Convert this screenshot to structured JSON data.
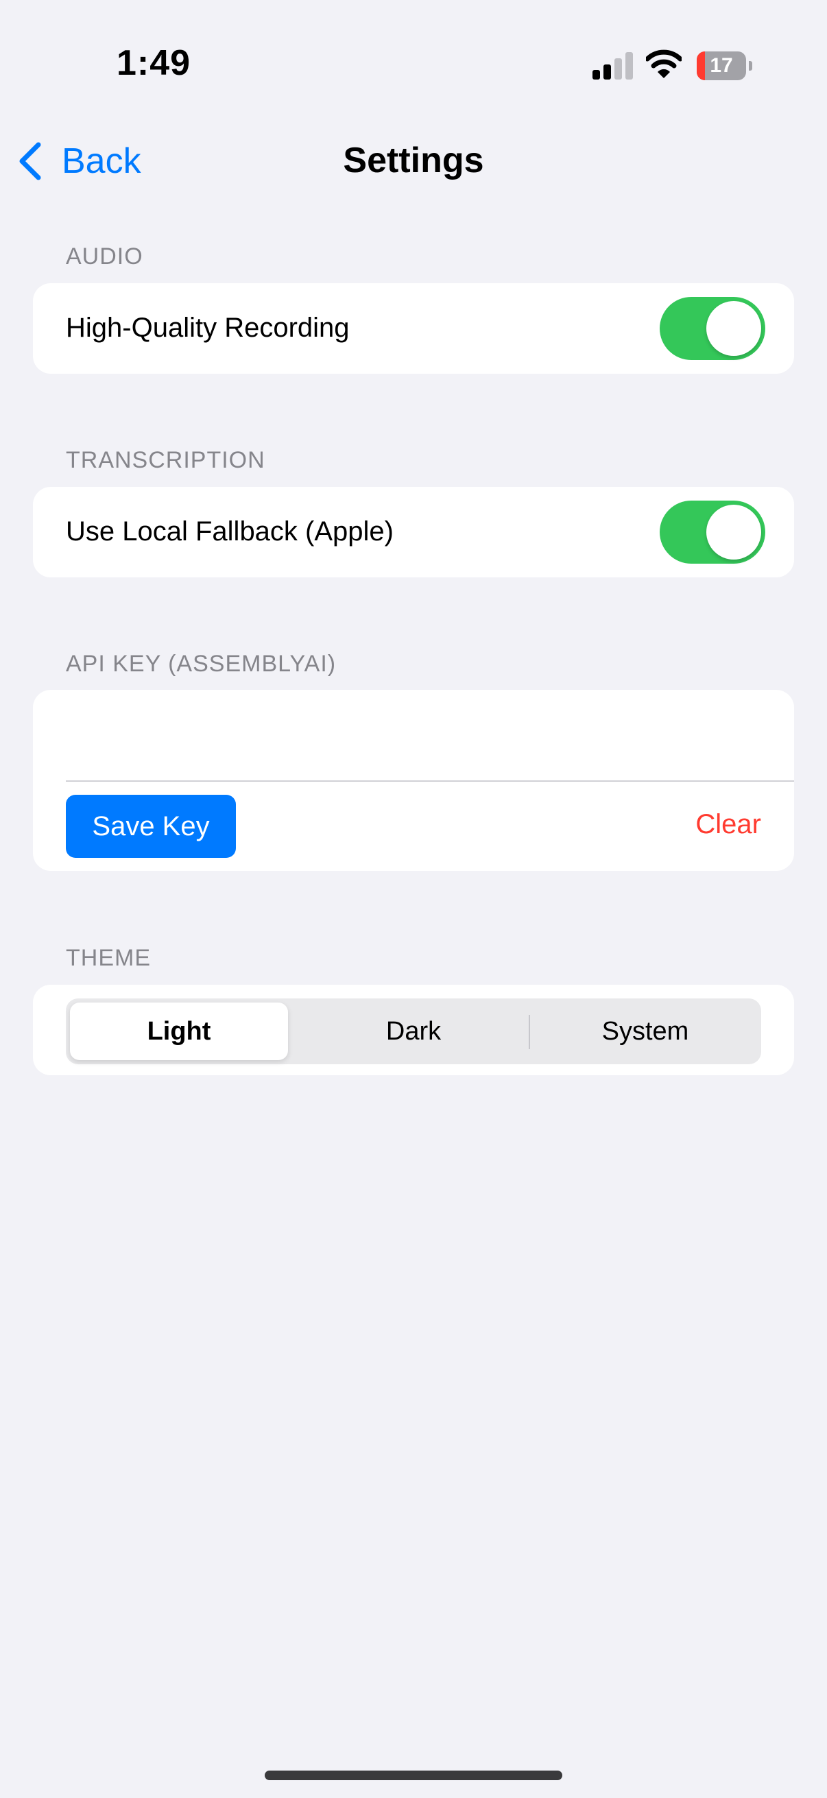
{
  "status_bar": {
    "time": "1:49",
    "battery_level": "17",
    "battery_fraction": 0.17,
    "colors": {
      "battery_low": "#FF3B30"
    }
  },
  "nav": {
    "back_label": "Back",
    "title": "Settings"
  },
  "sections": {
    "audio": {
      "header": "AUDIO",
      "row_label": "High-Quality Recording",
      "toggle_on": true
    },
    "transcription": {
      "header": "TRANSCRIPTION",
      "row_label": "Use Local Fallback (Apple)",
      "toggle_on": true
    },
    "api_key": {
      "header": "API KEY (ASSEMBLYAI)",
      "value": "",
      "save_label": "Save Key",
      "clear_label": "Clear"
    },
    "theme": {
      "header": "THEME",
      "options": [
        "Light",
        "Dark",
        "System"
      ],
      "selected": "Light"
    }
  },
  "colors": {
    "accent": "#007AFF",
    "toggle_on": "#34C759",
    "destructive": "#FF3B30",
    "background": "#F2F2F7"
  }
}
